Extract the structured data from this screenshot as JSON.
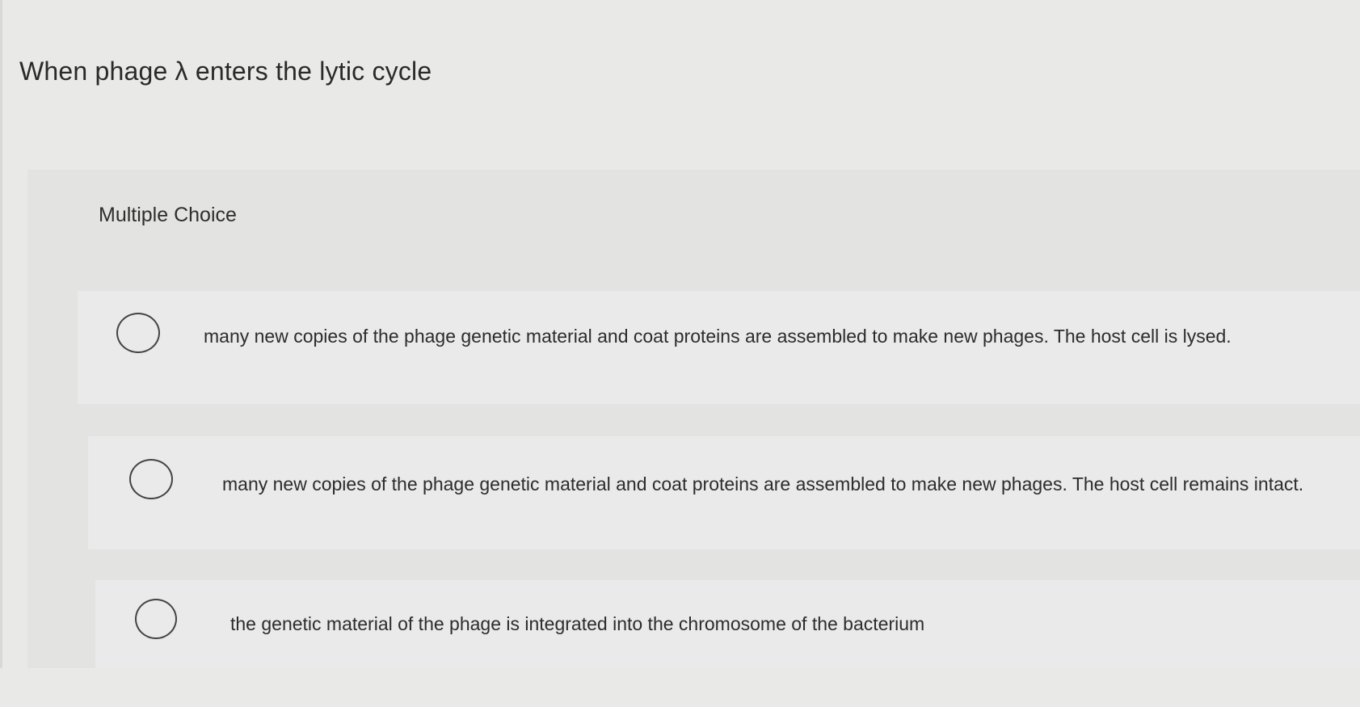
{
  "question": {
    "text": "When phage λ enters the lytic cycle"
  },
  "panel": {
    "title": "Multiple Choice"
  },
  "options": [
    {
      "label": "many new copies of the phage genetic material and coat proteins are assembled to make new phages. The host cell is lysed.",
      "selected": false
    },
    {
      "label": "many new copies of the phage genetic material and coat proteins are assembled to make new phages. The host cell remains intact.",
      "selected": false
    },
    {
      "label": "the genetic material of the phage is integrated into the chromosome of the bacterium",
      "selected": false
    }
  ]
}
